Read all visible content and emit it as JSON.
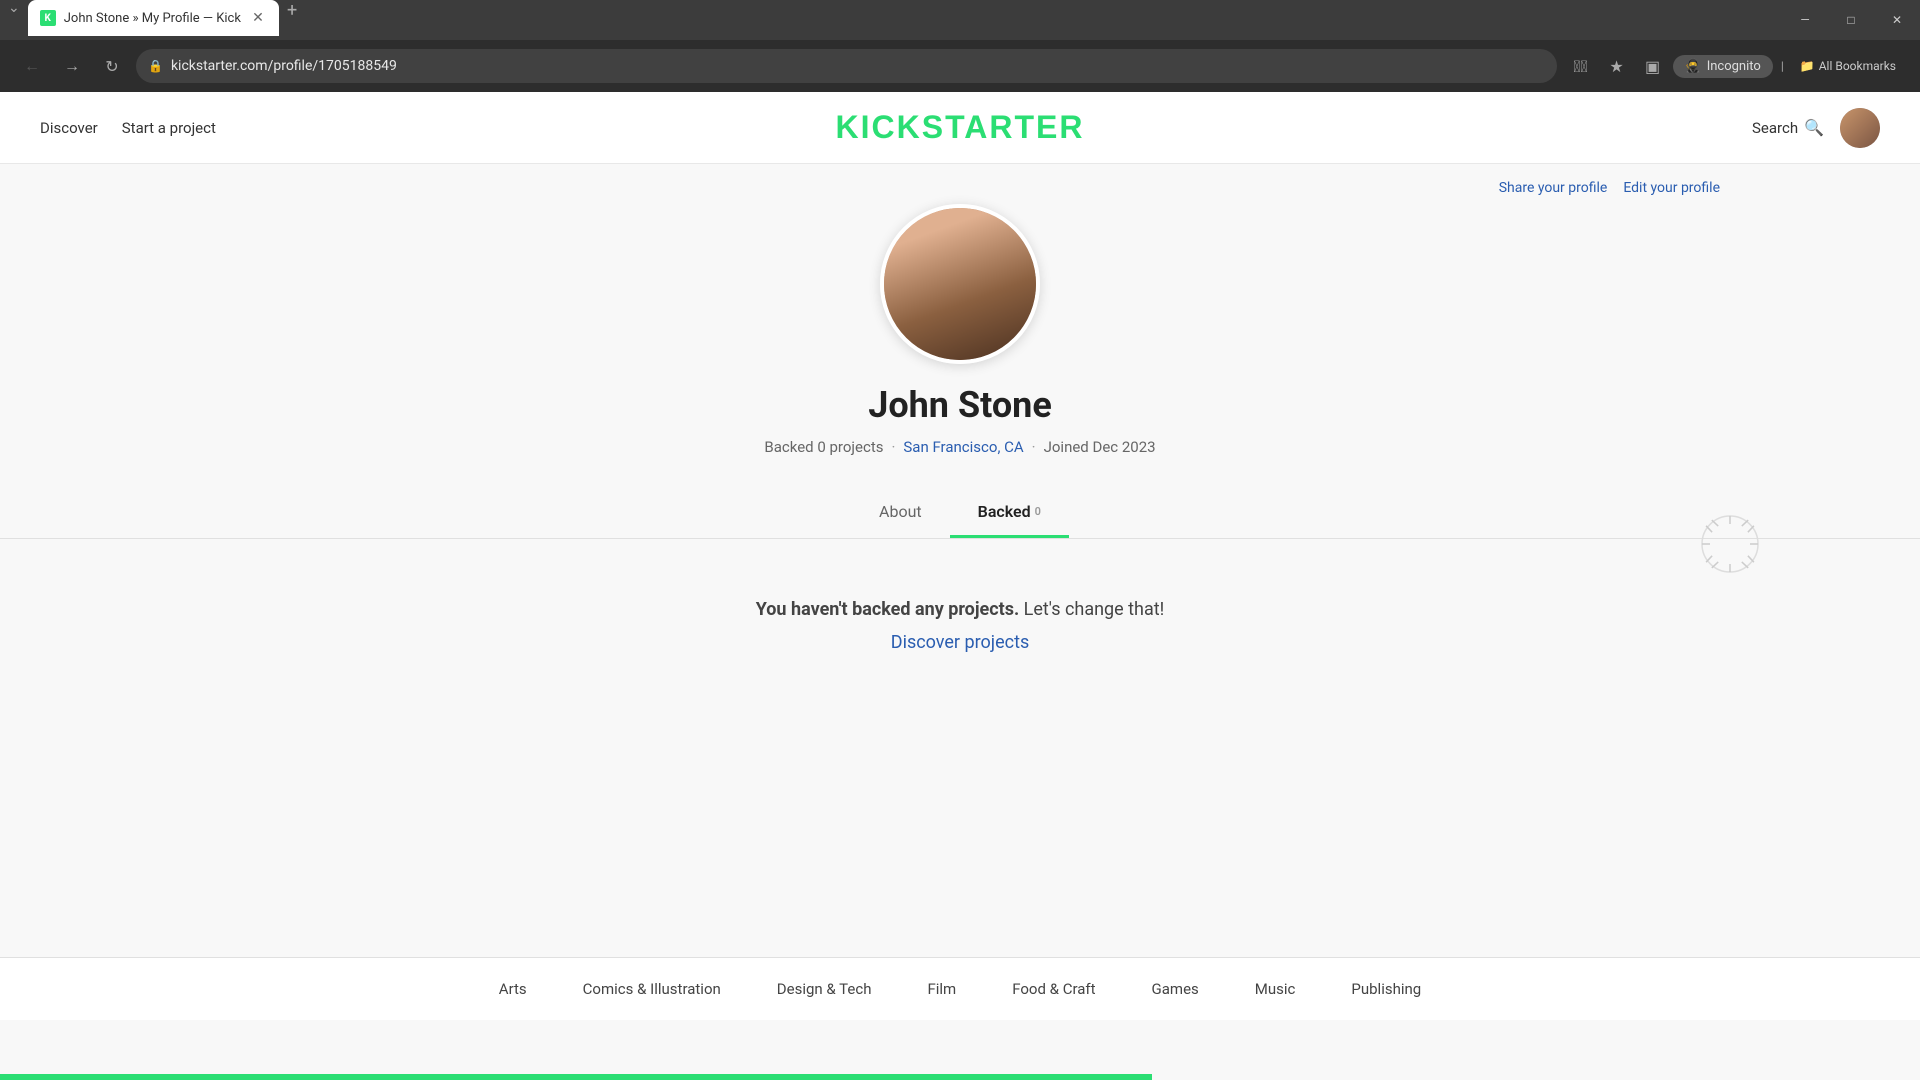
{
  "browser": {
    "tab_title": "John Stone » My Profile — Kick",
    "url": "kickstarter.com/profile/1705188549",
    "incognito_label": "Incognito",
    "bookmarks_label": "All Bookmarks",
    "new_tab_tooltip": "New tab"
  },
  "header": {
    "nav_discover": "Discover",
    "nav_start": "Start a project",
    "logo": "KICKSTARTER",
    "search_label": "Search",
    "share_profile": "Share your profile",
    "edit_profile": "Edit your profile"
  },
  "profile": {
    "name": "John Stone",
    "backed_count": "0",
    "backed_label": "Backed 0 projects",
    "location": "San Francisco, CA",
    "joined": "Joined Dec 2023",
    "tab_about": "About",
    "tab_backed": "Backed",
    "tab_backed_count": "0",
    "empty_bold": "You haven't backed any projects.",
    "empty_rest": " Let's change that!",
    "discover_link": "Discover projects"
  },
  "footer": {
    "categories": [
      "Arts",
      "Comics & Illustration",
      "Design & Tech",
      "Film",
      "Food & Craft",
      "Games",
      "Music",
      "Publishing"
    ]
  }
}
